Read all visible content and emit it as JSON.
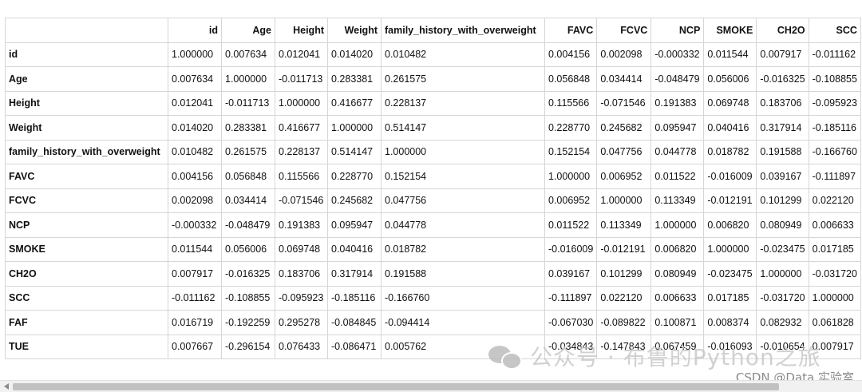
{
  "table": {
    "columns": [
      "id",
      "Age",
      "Height",
      "Weight",
      "family_history_with_overweight",
      "FAVC",
      "FCVC",
      "NCP",
      "SMOKE",
      "CH2O",
      "SCC"
    ],
    "rows": [
      {
        "label": "id",
        "values": [
          "1.000000",
          "0.007634",
          "0.012041",
          "0.014020",
          "0.010482",
          "0.004156",
          "0.002098",
          "-0.000332",
          "0.011544",
          "0.007917",
          "-0.011162"
        ]
      },
      {
        "label": "Age",
        "values": [
          "0.007634",
          "1.000000",
          "-0.011713",
          "0.283381",
          "0.261575",
          "0.056848",
          "0.034414",
          "-0.048479",
          "0.056006",
          "-0.016325",
          "-0.108855"
        ]
      },
      {
        "label": "Height",
        "values": [
          "0.012041",
          "-0.011713",
          "1.000000",
          "0.416677",
          "0.228137",
          "0.115566",
          "-0.071546",
          "0.191383",
          "0.069748",
          "0.183706",
          "-0.095923"
        ]
      },
      {
        "label": "Weight",
        "values": [
          "0.014020",
          "0.283381",
          "0.416677",
          "1.000000",
          "0.514147",
          "0.228770",
          "0.245682",
          "0.095947",
          "0.040416",
          "0.317914",
          "-0.185116"
        ]
      },
      {
        "label": "family_history_with_overweight",
        "values": [
          "0.010482",
          "0.261575",
          "0.228137",
          "0.514147",
          "1.000000",
          "0.152154",
          "0.047756",
          "0.044778",
          "0.018782",
          "0.191588",
          "-0.166760"
        ]
      },
      {
        "label": "FAVC",
        "values": [
          "0.004156",
          "0.056848",
          "0.115566",
          "0.228770",
          "0.152154",
          "1.000000",
          "0.006952",
          "0.011522",
          "-0.016009",
          "0.039167",
          "-0.111897"
        ]
      },
      {
        "label": "FCVC",
        "values": [
          "0.002098",
          "0.034414",
          "-0.071546",
          "0.245682",
          "0.047756",
          "0.006952",
          "1.000000",
          "0.113349",
          "-0.012191",
          "0.101299",
          "0.022120"
        ]
      },
      {
        "label": "NCP",
        "values": [
          "-0.000332",
          "-0.048479",
          "0.191383",
          "0.095947",
          "0.044778",
          "0.011522",
          "0.113349",
          "1.000000",
          "0.006820",
          "0.080949",
          "0.006633"
        ]
      },
      {
        "label": "SMOKE",
        "values": [
          "0.011544",
          "0.056006",
          "0.069748",
          "0.040416",
          "0.018782",
          "-0.016009",
          "-0.012191",
          "0.006820",
          "1.000000",
          "-0.023475",
          "0.017185"
        ]
      },
      {
        "label": "CH2O",
        "values": [
          "0.007917",
          "-0.016325",
          "0.183706",
          "0.317914",
          "0.191588",
          "0.039167",
          "0.101299",
          "0.080949",
          "-0.023475",
          "1.000000",
          "-0.031720"
        ]
      },
      {
        "label": "SCC",
        "values": [
          "-0.011162",
          "-0.108855",
          "-0.095923",
          "-0.185116",
          "-0.166760",
          "-0.111897",
          "0.022120",
          "0.006633",
          "0.017185",
          "-0.031720",
          "1.000000"
        ]
      },
      {
        "label": "FAF",
        "values": [
          "0.016719",
          "-0.192259",
          "0.295278",
          "-0.084845",
          "-0.094414",
          "-0.067030",
          "-0.089822",
          "0.100871",
          "0.008374",
          "0.082932",
          "0.061828"
        ]
      },
      {
        "label": "TUE",
        "values": [
          "0.007667",
          "-0.296154",
          "0.076433",
          "-0.086471",
          "0.005762",
          "-0.034843",
          "-0.147843",
          "0.067459",
          "-0.016093",
          "-0.010654",
          "0.007917"
        ]
      }
    ]
  },
  "watermark": {
    "icon": "wechat-icon",
    "text": "公众号 · 布鲁的Python之旅",
    "credit": "CSDN @Data 实验室"
  }
}
